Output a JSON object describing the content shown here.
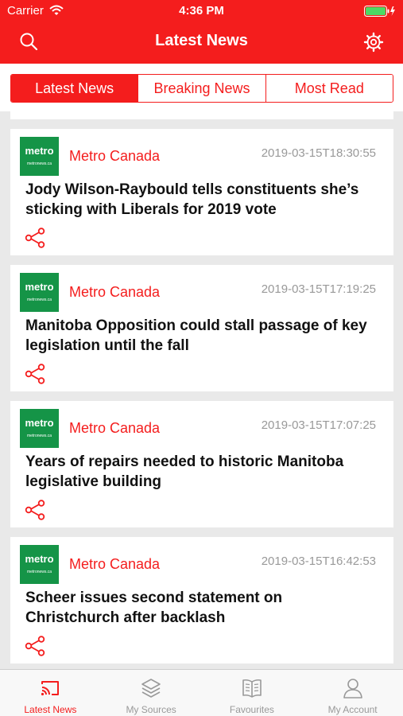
{
  "status_bar": {
    "carrier": "Carrier",
    "time": "4:36 PM"
  },
  "header": {
    "title": "Latest News",
    "left_icon": "search-icon",
    "right_icon": "gear-icon"
  },
  "segments": [
    {
      "label": "Latest News",
      "active": true
    },
    {
      "label": "Breaking News",
      "active": false
    },
    {
      "label": "Most Read",
      "active": false
    }
  ],
  "articles": [
    {
      "logo": "metro",
      "logo_sub": "metronews.ca",
      "source": "Metro Canada",
      "date": "2019-03-15T18:30:55",
      "headline": "Jody Wilson-Raybould tells constituents she’s sticking with Liberals for 2019 vote"
    },
    {
      "logo": "metro",
      "logo_sub": "metronews.ca",
      "source": "Metro Canada",
      "date": "2019-03-15T17:19:25",
      "headline": "Manitoba Opposition could stall passage of key legislation until the fall"
    },
    {
      "logo": "metro",
      "logo_sub": "metronews.ca",
      "source": "Metro Canada",
      "date": "2019-03-15T17:07:25",
      "headline": "Years of repairs needed to historic Manitoba legislative building"
    },
    {
      "logo": "metro",
      "logo_sub": "metronews.ca",
      "source": "Metro Canada",
      "date": "2019-03-15T16:42:53",
      "headline": "Scheer issues second statement on Christchurch after backlash"
    }
  ],
  "tabbar": [
    {
      "label": "Latest News",
      "icon": "cast-icon",
      "active": true
    },
    {
      "label": "My Sources",
      "icon": "layers-icon",
      "active": false
    },
    {
      "label": "Favourites",
      "icon": "book-icon",
      "active": false
    },
    {
      "label": "My Account",
      "icon": "person-icon",
      "active": false
    }
  ],
  "colors": {
    "accent": "#f41d1d",
    "logo_green": "#159447",
    "date_gray": "#999999",
    "background": "#e9e9e9"
  }
}
